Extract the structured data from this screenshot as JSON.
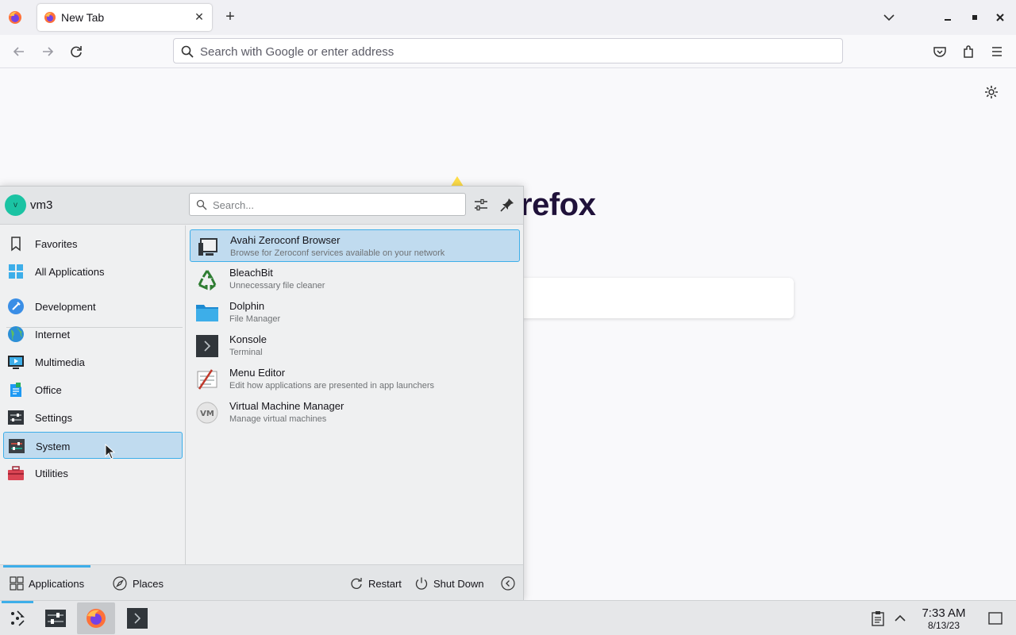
{
  "browser": {
    "tab_title": "New Tab",
    "url_placeholder": "Search with Google or enter address",
    "logo_text": "refox"
  },
  "launcher": {
    "username": "vm3",
    "avatar_letter": "v",
    "search_placeholder": "Search...",
    "categories": [
      {
        "label": "Favorites"
      },
      {
        "label": "All Applications"
      },
      {
        "label": "Development"
      },
      {
        "label": "Internet"
      },
      {
        "label": "Multimedia"
      },
      {
        "label": "Office"
      },
      {
        "label": "Settings"
      },
      {
        "label": "System",
        "selected": true
      },
      {
        "label": "Utilities"
      }
    ],
    "apps": [
      {
        "name": "Avahi Zeroconf Browser",
        "desc": "Browse for Zeroconf services available on your network",
        "selected": true
      },
      {
        "name": "BleachBit",
        "desc": "Unnecessary file cleaner"
      },
      {
        "name": "Dolphin",
        "desc": "File Manager"
      },
      {
        "name": "Konsole",
        "desc": "Terminal"
      },
      {
        "name": "Menu Editor",
        "desc": "Edit how applications are presented in app launchers"
      },
      {
        "name": "Virtual Machine Manager",
        "desc": "Manage virtual machines"
      }
    ],
    "footer": {
      "applications_label": "Applications",
      "places_label": "Places",
      "restart_label": "Restart",
      "shutdown_label": "Shut Down"
    }
  },
  "taskbar": {
    "time": "7:33 AM",
    "date": "8/13/23"
  },
  "colors": {
    "accent": "#3daee9",
    "selection": "#c0dbef"
  }
}
